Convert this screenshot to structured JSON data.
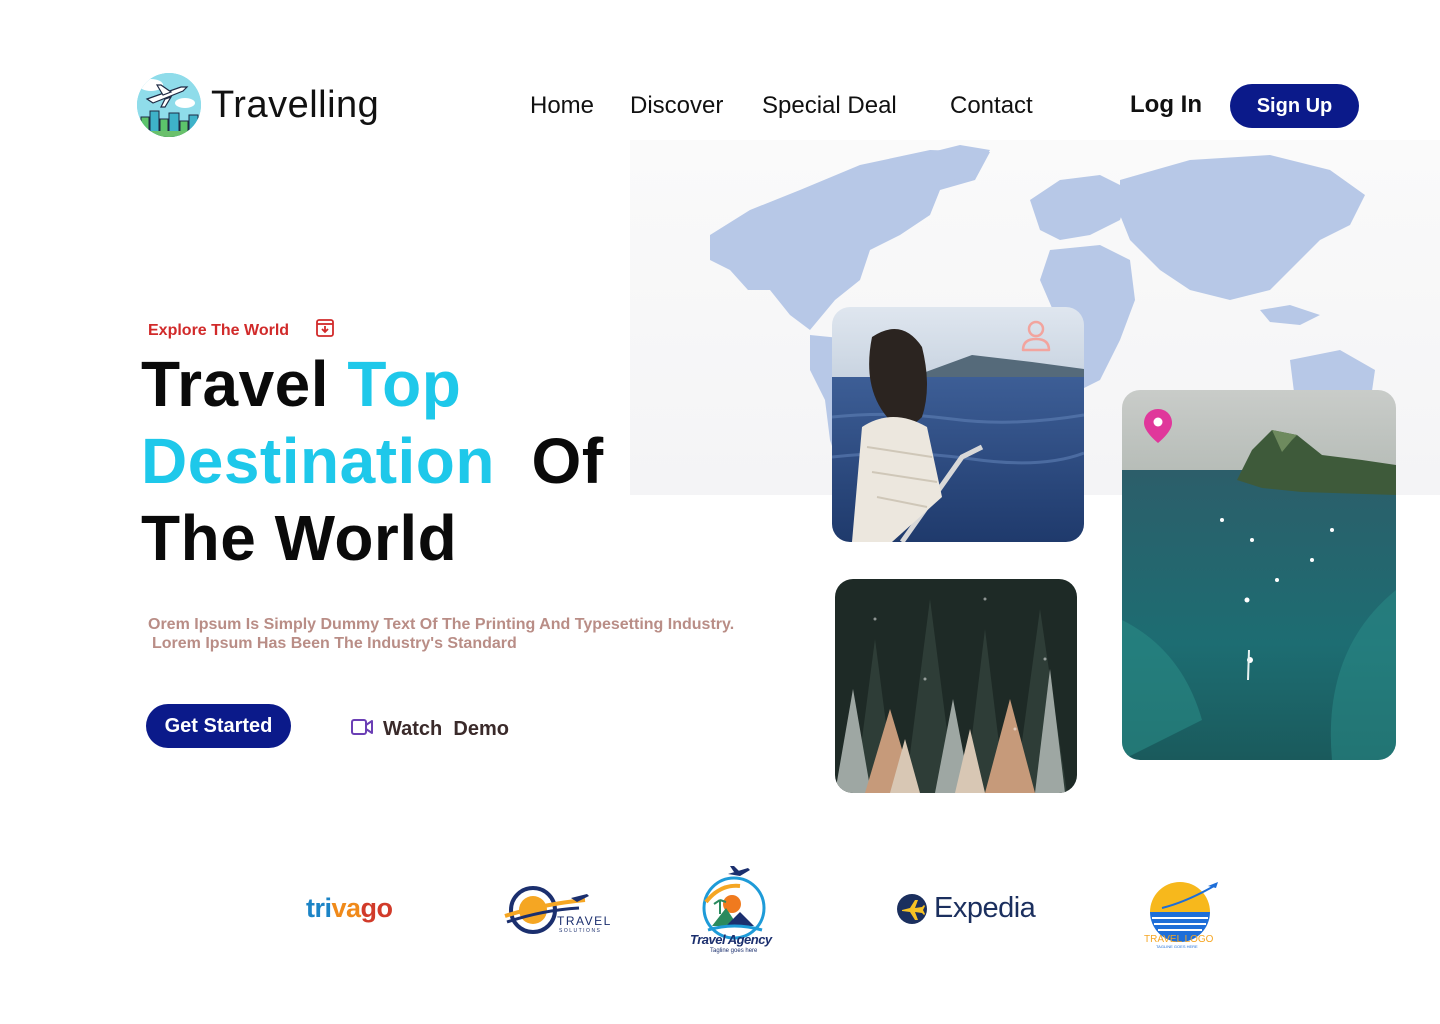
{
  "brand": {
    "name": "Travelling",
    "logo_icon": "airplane-city-icon"
  },
  "nav": {
    "items": [
      {
        "label": "Home"
      },
      {
        "label": "Discover"
      },
      {
        "label": "Special Deal"
      },
      {
        "label": "Contact"
      }
    ],
    "login_label": "Log In",
    "signup_label": "Sign Up"
  },
  "hero": {
    "eyebrow": "Explore The World",
    "eyebrow_icon": "download-box-icon",
    "title_part1": "Travel ",
    "title_highlight1": "Top",
    "title_highlight2": "Destination",
    "title_part2": "  Of",
    "title_line3": "The World",
    "description_line1": "Orem Ipsum Is Simply Dummy Text Of The Printing And Typesetting Industry.",
    "description_line2": "Lorem Ipsum Has Been The Industry's Standard",
    "cta_label": "Get Started",
    "demo_label": "Watch  Demo",
    "demo_icon": "video-camera-icon"
  },
  "gallery": {
    "person_icon": "user-icon",
    "pin_icon": "location-pin-icon"
  },
  "partners": {
    "trivago": {
      "part1": "tri",
      "part2": "va",
      "part3": "go"
    },
    "travel_solutions": {
      "title": "TRAVEL",
      "subtitle": "SOLUTIONS"
    },
    "travel_agency": {
      "title": "Travel Agency",
      "tagline": "Tagline goes here"
    },
    "expedia": {
      "name": "Expedia"
    },
    "travel_logo": {
      "title": "TRAVEL LOGO",
      "tagline": "TAGLINE GOES HERE"
    }
  },
  "colors": {
    "primary": "#0b1a8a",
    "accent": "#1ec8ea",
    "eyebrow": "#d12a2a",
    "description": "#b98d86",
    "map": "#b7c8e7",
    "pin": "#e0379b",
    "person": "#f2a49e"
  }
}
